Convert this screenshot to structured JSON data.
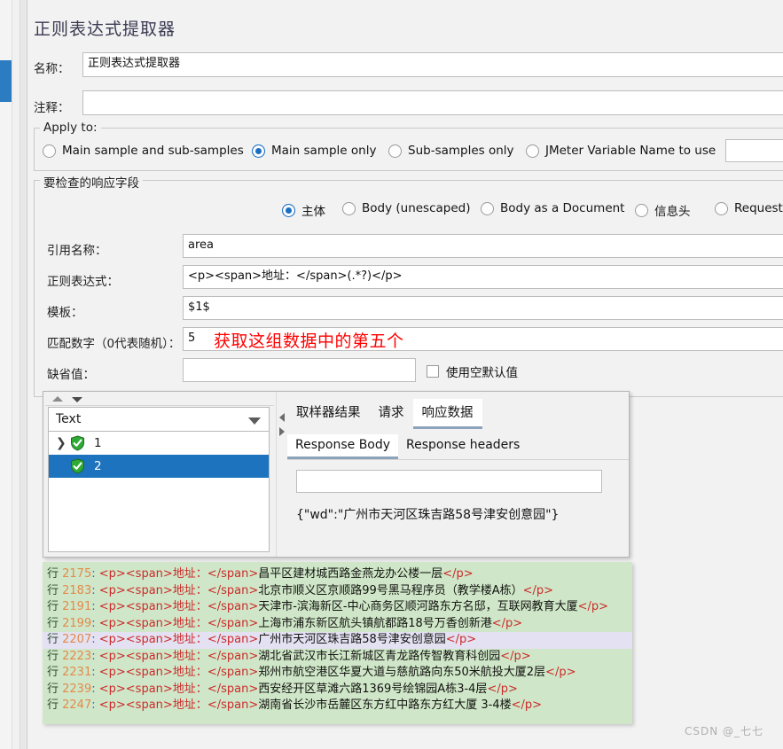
{
  "title": "正则表达式提取器",
  "fields": {
    "name_label": "名称：",
    "name_value": "正则表达式提取器",
    "comment_label": "注释：",
    "comment_value": "",
    "refname_label": "引用名称：",
    "refname_value": "area",
    "regex_label": "正则表达式：",
    "regex_value": "<p><span>地址：</span>(.*?)</p>",
    "template_label": "模板：",
    "template_value": "$1$",
    "matchno_label": "匹配数字（0代表随机）：",
    "matchno_value": "5",
    "default_label": "缺省值：",
    "default_value": "",
    "use_empty_default_label": "使用空默认值",
    "jmeter_var_value": ""
  },
  "apply_to": {
    "legend": "Apply to:",
    "options": [
      {
        "label": "Main sample and sub-samples",
        "selected": false
      },
      {
        "label": "Main sample only",
        "selected": true
      },
      {
        "label": "Sub-samples only",
        "selected": false
      },
      {
        "label": "JMeter Variable Name to use",
        "selected": false
      }
    ]
  },
  "field_to_check": {
    "legend": "要检查的响应字段",
    "options": [
      {
        "label": "主体",
        "selected": true
      },
      {
        "label": "Body (unescaped)",
        "selected": false
      },
      {
        "label": "Body as a Document",
        "selected": false
      },
      {
        "label": "信息头",
        "selected": false
      },
      {
        "label": "Request",
        "selected": false
      }
    ]
  },
  "annotation": "获取这组数据中的第五个",
  "results": {
    "tree": {
      "filter_value": "Text",
      "rows": [
        {
          "label": "1",
          "expandable": true,
          "selected": false
        },
        {
          "label": "2",
          "expandable": false,
          "selected": true
        }
      ]
    },
    "tabs_primary": [
      {
        "label": "取样器结果",
        "active": false
      },
      {
        "label": "请求",
        "active": false
      },
      {
        "label": "响应数据",
        "active": true
      }
    ],
    "tabs_secondary": [
      {
        "label": "Response Body",
        "active": true
      },
      {
        "label": "Response headers",
        "active": false
      }
    ],
    "search_value": "",
    "response_body": "{\"wd\":\"广州市天河区珠吉路58号津安创意园\"}"
  },
  "code_block": {
    "line_prefix": "行",
    "tag_open": "<p><span>地址：",
    "tag_close": "</span>",
    "tag_end": "</p>",
    "lines": [
      {
        "num": "2175",
        "text": "昌平区建材城西路金燕龙办公楼一层",
        "highlight": false
      },
      {
        "num": "2183",
        "text": "北京市顺义区京顺路99号黑马程序员（教学楼A栋）",
        "highlight": false
      },
      {
        "num": "2191",
        "text": "天津市-滨海新区-中心商务区顺河路东方名邸，互联网教育大厦",
        "highlight": false
      },
      {
        "num": "2199",
        "text": "上海市浦东新区航头镇航都路18号万香创新港",
        "highlight": false
      },
      {
        "num": "2207",
        "text": "广州市天河区珠吉路58号津安创意园",
        "highlight": true
      },
      {
        "num": "2223",
        "text": "湖北省武汉市长江新城区青龙路传智教育科创园",
        "highlight": false
      },
      {
        "num": "2231",
        "text": "郑州市航空港区华夏大道与慈航路向东50米航投大厦2层",
        "highlight": false
      },
      {
        "num": "2239",
        "text": "西安经开区草滩六路1369号绘锦园A栋3-4层",
        "highlight": false
      },
      {
        "num": "2247",
        "text": "湖南省长沙市岳麓区东方红中路东方红大厦 3-4楼",
        "highlight": false
      }
    ]
  },
  "watermark": "CSDN @_七七"
}
